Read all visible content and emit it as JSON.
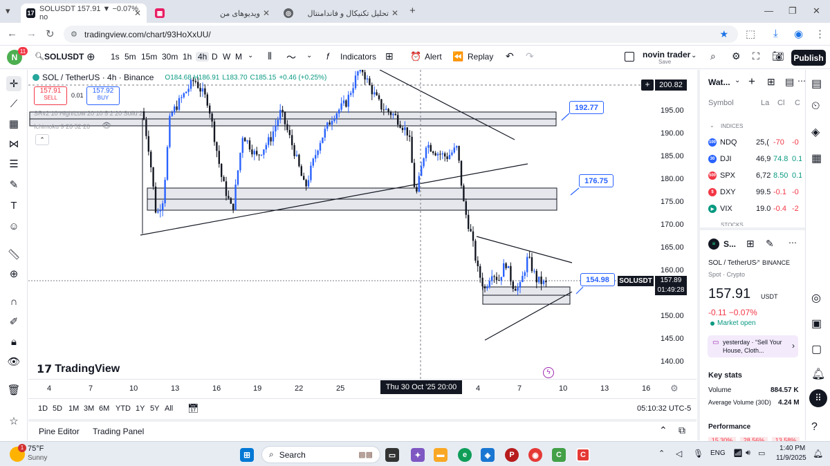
{
  "browser": {
    "tabs": [
      {
        "title": "SOLUSDT 157.91 ▼ −0.07% no",
        "active": true
      },
      {
        "title": "ویدیوهای من",
        "active": false
      },
      {
        "title": "تحلیل تکنیکال و فاندامنتال",
        "active": false
      }
    ],
    "url": "tradingview.com/chart/93HoXxUU/"
  },
  "toolbar": {
    "avatar_letter": "N",
    "avatar_badge": "11",
    "symbol": "SOLUSDT",
    "intervals": [
      "1s",
      "5m",
      "15m",
      "30m",
      "1h",
      "4h",
      "D",
      "W",
      "M"
    ],
    "selected_interval": "4h",
    "indicators_label": "Indicators",
    "alert_label": "Alert",
    "replay_label": "Replay",
    "account_name": "novin trader",
    "account_sub": "Save",
    "publish_label": "Publish"
  },
  "legend": {
    "title": "SOL / TetherUS · 4h · Binance",
    "ohlc_prefix": "O184.68 H186.91",
    "low": "L183.70",
    "close": "C185.15",
    "change": "+0.46 (+0.25%)",
    "sell_price": "157.91",
    "sell_label": "SELL",
    "spread": "0.01",
    "buy_price": "157.92",
    "buy_label": "BUY",
    "indicator1": "SRv2 10 High/Low 20 10 5 2 20 Solid 2",
    "indicator2": "Ichimoku 9 26 52 26"
  },
  "chart": {
    "price_ticks": [
      "195.00",
      "190.00",
      "185.00",
      "180.00",
      "175.00",
      "170.00",
      "165.00",
      "160.00",
      "155.00",
      "150.00",
      "145.00",
      "140.00"
    ],
    "time_ticks": [
      "4",
      "7",
      "10",
      "13",
      "16",
      "19",
      "22",
      "25",
      "4",
      "7",
      "10",
      "13",
      "16"
    ],
    "crosshair_time": "Thu 30 Oct '25   20:00",
    "crosshair_price": "200.82",
    "last_symbol": "SOLUSDT",
    "last_price": "157.89",
    "countdown": "01:49:28",
    "labels": [
      "192.77",
      "176.75",
      "154.98"
    ],
    "brand": "TradingView"
  },
  "range": {
    "items": [
      "1D",
      "5D",
      "1M",
      "3M",
      "6M",
      "YTD",
      "1Y",
      "5Y",
      "All"
    ],
    "clock": "05:10:32 UTC-5"
  },
  "bottom": {
    "pine_editor": "Pine Editor",
    "trading_panel": "Trading Panel"
  },
  "watchlist": {
    "title": "Wat...",
    "col_symbol": "Symbol",
    "col_last": "La",
    "col_chg": "Cl",
    "col_chgp": "C",
    "section_indices": "INDICES",
    "rows": [
      {
        "sym": "NDQ",
        "last": "25,(",
        "chg": "-70",
        "chgp": "-0",
        "color": "#2962ff",
        "badge": "100"
      },
      {
        "sym": "DJI",
        "last": "46,9",
        "chg": "74.8",
        "chgp": "0.1",
        "color": "#2962ff",
        "badge": "30"
      },
      {
        "sym": "SPX",
        "last": "6,72",
        "chg": "8.50",
        "chgp": "0.1",
        "color": "#f23645",
        "badge": "500"
      },
      {
        "sym": "DXY",
        "last": "99.5",
        "chg": "-0.1",
        "chgp": "-0",
        "color": "#f23645",
        "badge": "$"
      },
      {
        "sym": "VIX",
        "last": "19.0",
        "chg": "-0.4",
        "chgp": "-2",
        "color": "#089981",
        "badge": "▶"
      }
    ],
    "section_stocks": "STOCKS",
    "detail": {
      "symbol_short": "S...",
      "name": "SOL / TetherUS",
      "exchange": "BINANCE",
      "type": "Spot · Crypto",
      "price": "157.91",
      "currency": "USDT",
      "change": "-0.11  −0.07%",
      "status": "Market open",
      "news": "yesterday · “Sell Your House, Cloth...",
      "key_stats": "Key stats",
      "volume_label": "Volume",
      "volume_value": "884.57 K",
      "avg_label": "Average Volume (30D)",
      "avg_value": "4.24 M",
      "performance": "Performance",
      "perf_values": [
        "15.30%",
        "28.56%",
        "13.58%"
      ]
    }
  },
  "taskbar": {
    "weather_temp": "75°F",
    "weather_desc": "Sunny",
    "weather_badge": "1",
    "search_label": "Search",
    "lang": "ENG",
    "time": "1:40 PM",
    "date": "11/9/2025"
  },
  "colors": {
    "bull": "#2962ff",
    "bear": "#131722",
    "accent": "#2962ff",
    "down": "#f23645",
    "up": "#089981"
  }
}
